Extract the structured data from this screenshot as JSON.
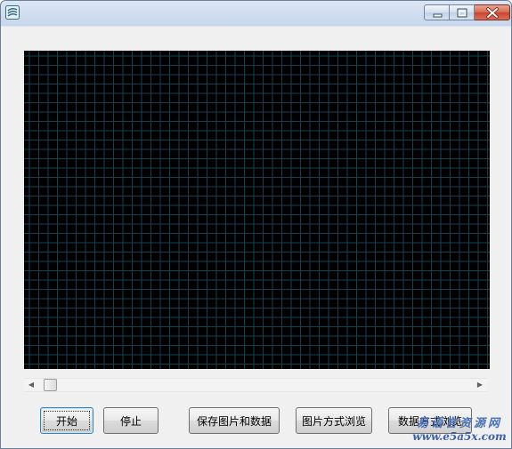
{
  "window": {
    "title": "",
    "controls": [
      "minimize-icon",
      "maximize-icon",
      "close-icon"
    ]
  },
  "colors": {
    "plot_background": "#000000",
    "grid_line": "#16414f",
    "title_gradient_top": "#dbe6f4",
    "close_red": "#c9442b"
  },
  "plot": {
    "grid": true
  },
  "buttons": {
    "start": "开始",
    "stop": "停止",
    "save": "保存图片和数据",
    "browse_image": "图片方式浏览",
    "browse_data": "数据方式浏览"
  },
  "watermark": {
    "text": "易语言资源网",
    "url": "www.e5a5x.com"
  }
}
